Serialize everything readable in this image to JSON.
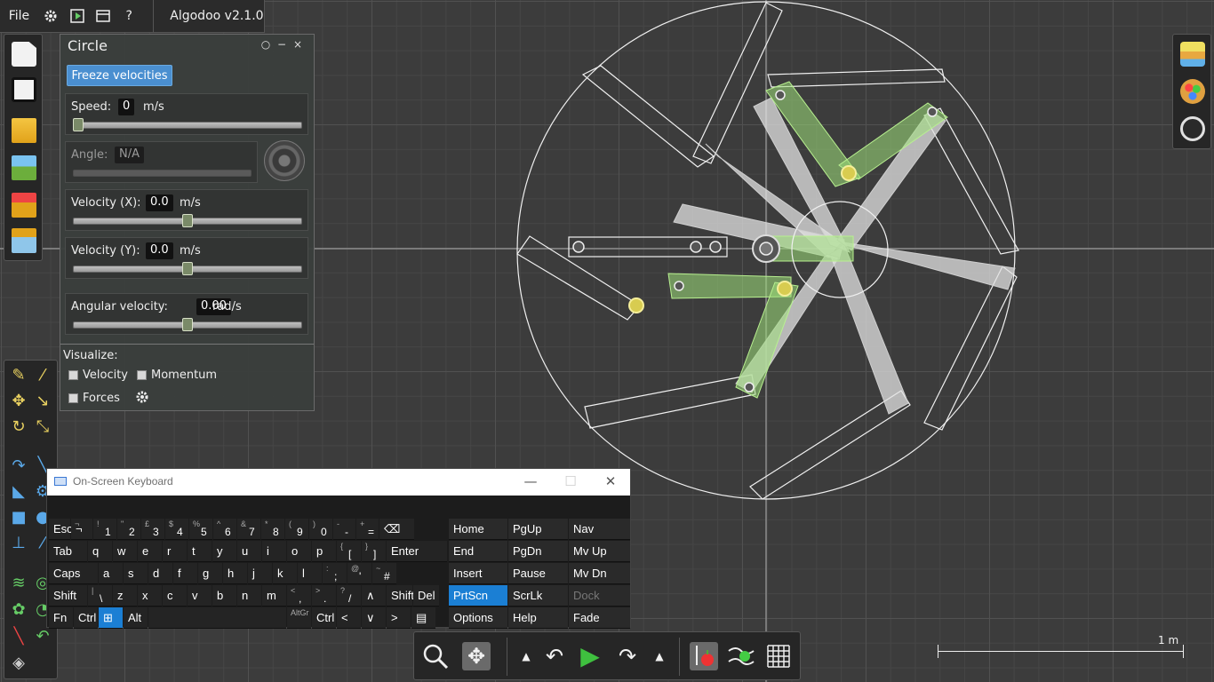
{
  "menubar": {
    "file_label": "File",
    "app_title": "Algodoo v2.1.0",
    "icons": [
      "gear-icon",
      "play-scene-icon",
      "window-icon",
      "help-icon"
    ],
    "help_glyph": "?"
  },
  "panel": {
    "title": "Circle",
    "freeze_label": "Freeze velocities",
    "speed": {
      "label": "Speed:",
      "value": "0",
      "unit": "m/s",
      "slider": 0.0
    },
    "angle": {
      "label": "Angle:",
      "value": "N/A"
    },
    "velocity_x": {
      "label": "Velocity (X):",
      "value": "0.0",
      "unit": "m/s",
      "slider": 0.5
    },
    "velocity_y": {
      "label": "Velocity (Y):",
      "value": "0.0",
      "unit": "m/s",
      "slider": 0.5
    },
    "angular_velocity": {
      "label": "Angular velocity:",
      "value": "0.00",
      "unit": "rad/s",
      "slider": 0.5
    },
    "visualize": {
      "label": "Visualize:",
      "velocity": "Velocity",
      "momentum": "Momentum",
      "forces": "Forces"
    }
  },
  "osk": {
    "title": "On-Screen Keyboard",
    "rows": [
      [
        {
          "l": "Esc"
        },
        {
          "l": "¬",
          "s": "¬"
        },
        {
          "b": "1",
          "s": "!"
        },
        {
          "b": "2",
          "s": "\""
        },
        {
          "b": "3",
          "s": "£"
        },
        {
          "b": "4",
          "s": "$"
        },
        {
          "b": "5",
          "s": "%"
        },
        {
          "b": "6",
          "s": "^"
        },
        {
          "b": "7",
          "s": "&"
        },
        {
          "b": "8",
          "s": "*"
        },
        {
          "b": "9",
          "s": "("
        },
        {
          "b": "0",
          "s": ")"
        },
        {
          "b": "-",
          "s": "-"
        },
        {
          "b": "=",
          "s": "+"
        },
        {
          "l": "⌫"
        }
      ],
      [
        {
          "l": "Tab"
        },
        {
          "l": "q"
        },
        {
          "l": "w"
        },
        {
          "l": "e"
        },
        {
          "l": "r"
        },
        {
          "l": "t"
        },
        {
          "l": "y"
        },
        {
          "l": "u"
        },
        {
          "l": "i"
        },
        {
          "l": "o"
        },
        {
          "l": "p"
        },
        {
          "b": "[",
          "s": "{"
        },
        {
          "b": "]",
          "s": "}"
        },
        {
          "l": "Enter"
        }
      ],
      [
        {
          "l": "Caps"
        },
        {
          "l": "a"
        },
        {
          "l": "s"
        },
        {
          "l": "d"
        },
        {
          "l": "f"
        },
        {
          "l": "g"
        },
        {
          "l": "h"
        },
        {
          "l": "j"
        },
        {
          "l": "k"
        },
        {
          "l": "l"
        },
        {
          "b": ";",
          "s": ":"
        },
        {
          "b": "'",
          "s": "@"
        },
        {
          "b": "#",
          "s": "~"
        }
      ],
      [
        {
          "l": "Shift"
        },
        {
          "b": "\\",
          "s": "|"
        },
        {
          "l": "z"
        },
        {
          "l": "x"
        },
        {
          "l": "c"
        },
        {
          "l": "v"
        },
        {
          "l": "b"
        },
        {
          "l": "n"
        },
        {
          "l": "m"
        },
        {
          "b": ",",
          "s": "<"
        },
        {
          "b": ".",
          "s": ">"
        },
        {
          "b": "/",
          "s": "?"
        },
        {
          "l": "∧"
        },
        {
          "l": "Shift"
        },
        {
          "l": "Del"
        }
      ],
      [
        {
          "l": "Fn"
        },
        {
          "l": "Ctrl"
        },
        {
          "l": "⊞"
        },
        {
          "l": "Alt"
        },
        {
          "l": ""
        },
        {
          "s": "AltGr"
        },
        {
          "l": "Ctrl"
        },
        {
          "l": "<"
        },
        {
          "l": "∨"
        },
        {
          "l": ">"
        },
        {
          "l": "▤"
        }
      ]
    ],
    "nav": [
      [
        "Home",
        "PgUp",
        "Nav"
      ],
      [
        "End",
        "PgDn",
        "Mv Up"
      ],
      [
        "Insert",
        "Pause",
        "Mv Dn"
      ],
      [
        "PrtScn",
        "ScrLk",
        "Dock"
      ],
      [
        "Options",
        "Help",
        "Fade"
      ]
    ]
  },
  "bottom_toolbar": {
    "icons": [
      "zoom-icon",
      "pan-icon",
      "arrow-up-icon",
      "undo-icon",
      "play-icon",
      "redo-icon",
      "arrow-up-icon",
      "gravity-icon",
      "air-friction-icon",
      "grid-icon"
    ]
  },
  "scale": {
    "label": "1 m"
  }
}
